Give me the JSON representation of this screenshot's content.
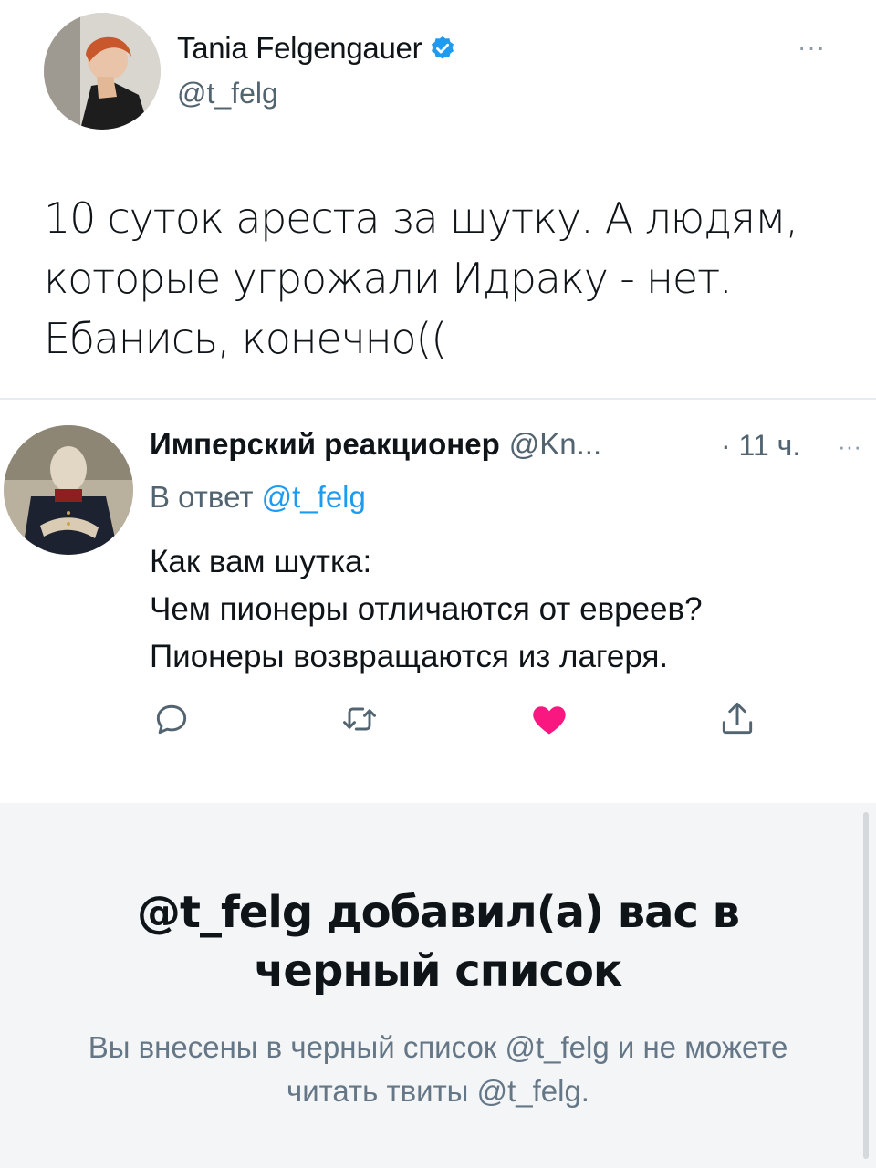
{
  "main_tweet": {
    "author_name": "Tania Felgengauer",
    "author_handle": "@t_felg",
    "text": "10 суток ареста за шутку. А людям, которые угрожали Идраку - нет. Ебанись, конечно((",
    "more_label": "···"
  },
  "reply": {
    "author_name": "Имперский реакционер",
    "author_handle": "@Kn...",
    "time": "· 11 ч.",
    "more_label": "···",
    "reply_prefix": "В ответ",
    "reply_mention": "@t_felg",
    "text_lines": [
      "Как вам шутка:",
      "Чем пионеры отличаются от евреев?",
      "Пионеры возвращаются из лагеря."
    ],
    "actions": [
      "reply-icon",
      "retweet-icon",
      "like-icon-filled",
      "share-icon"
    ]
  },
  "blocked": {
    "title": "@t_felg добавил(а) вас в черный список",
    "description": "Вы внесены в черный список @t_felg и не можете читать твиты @t_felg."
  },
  "colors": {
    "accent": "#1d9bf0",
    "like": "#f91880",
    "panel_bg": "#f3f5f7",
    "secondary_text": "#536471"
  }
}
